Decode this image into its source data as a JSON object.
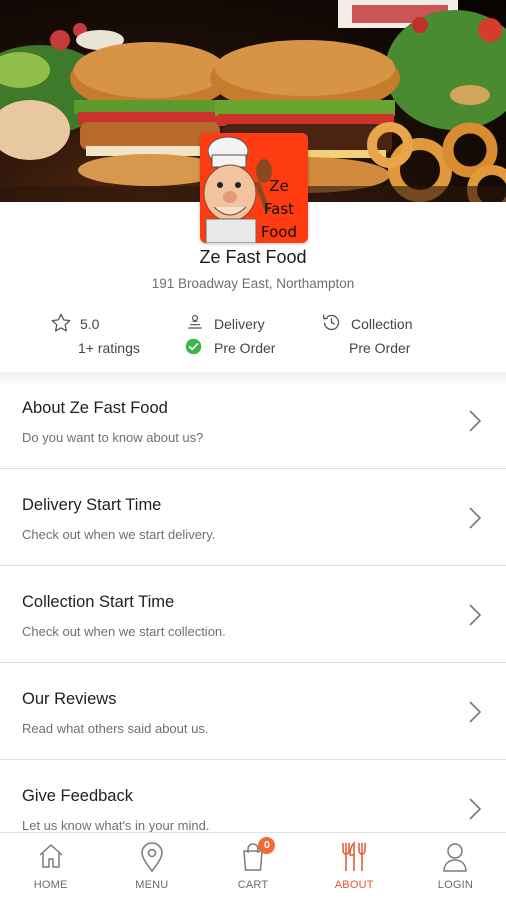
{
  "store": {
    "logo_text": [
      "Ze",
      "Fast",
      "Food"
    ],
    "name": "Ze Fast Food",
    "address": "191 Broadway East, Northampton"
  },
  "info": {
    "rating": {
      "icon": "star-icon",
      "value": "5.0",
      "count": "1+ ratings"
    },
    "delivery": {
      "icon": "delivery-scooter-icon",
      "label": "Delivery",
      "status_icon": "check-circle-icon",
      "status": "Pre Order"
    },
    "collection": {
      "icon": "clock-history-icon",
      "label": "Collection",
      "status": "Pre Order"
    }
  },
  "list": [
    {
      "title": "About Ze Fast Food",
      "subtitle": "Do you want to know about us?"
    },
    {
      "title": "Delivery Start Time",
      "subtitle": "Check out when we start delivery."
    },
    {
      "title": "Collection Start Time",
      "subtitle": "Check out when we start collection."
    },
    {
      "title": "Our Reviews",
      "subtitle": "Read what others said about us."
    },
    {
      "title": "Give Feedback",
      "subtitle": "Let us know what's in your mind."
    }
  ],
  "nav": {
    "items": [
      {
        "label": "HOME",
        "icon": "home-icon"
      },
      {
        "label": "MENU",
        "icon": "map-pin-icon"
      },
      {
        "label": "CART",
        "icon": "shopping-bag-icon",
        "badge": "0"
      },
      {
        "label": "ABOUT",
        "icon": "fork-knife-icon",
        "active": true
      },
      {
        "label": "LOGIN",
        "icon": "user-icon"
      }
    ]
  },
  "colors": {
    "accent": "#e4572e",
    "badge": "#f06b35",
    "check": "#3cb54a",
    "logo_bg": "#ff3b12"
  }
}
